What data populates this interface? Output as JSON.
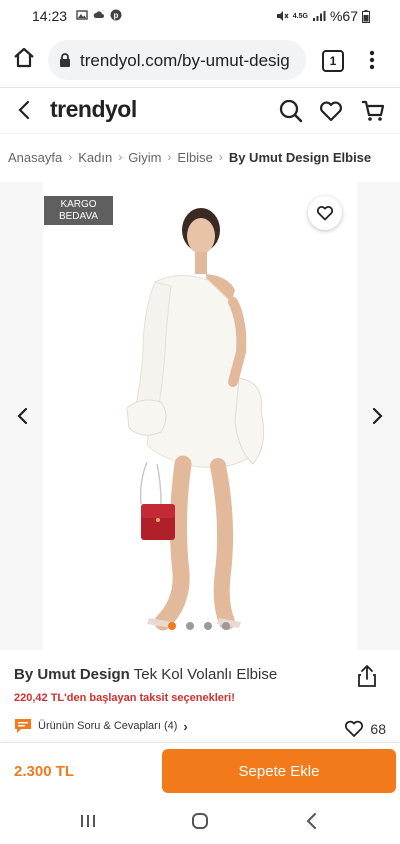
{
  "status_bar": {
    "time": "14:23",
    "battery": "%67",
    "network": "4.5G",
    "icons": [
      "image-icon",
      "cloud-icon",
      "pinterest-icon",
      "mute-icon",
      "signal-icon",
      "battery-icon"
    ]
  },
  "browser": {
    "url": "trendyol.com/by-umut-desig",
    "tab_count": "1"
  },
  "header": {
    "logo": "trendyol",
    "icons": [
      "back-arrow-icon",
      "search-icon",
      "heart-icon",
      "cart-icon"
    ]
  },
  "breadcrumb": {
    "items": [
      "Anasayfa",
      "Kadın",
      "Giyim",
      "Elbise"
    ],
    "current": "By Umut Design Elbise"
  },
  "gallery": {
    "badge_line1": "KARGO",
    "badge_line2": "BEDAVA",
    "image_count": 4,
    "active_index": 0
  },
  "product": {
    "brand": "By Umut Design",
    "name": "Tek Kol Volanlı Elbise",
    "installment": "220,42 TL'den başlayan taksit seçenekleri!",
    "qa_label": "Ürünün Soru & Cevapları (4)",
    "likes": "68"
  },
  "purchase": {
    "price": "2.300 TL",
    "button_label": "Sepete Ekle"
  },
  "colors": {
    "accent": "#f27a1a",
    "installment_red": "#d32f2f",
    "badge_bg": "#5f5f5f"
  }
}
